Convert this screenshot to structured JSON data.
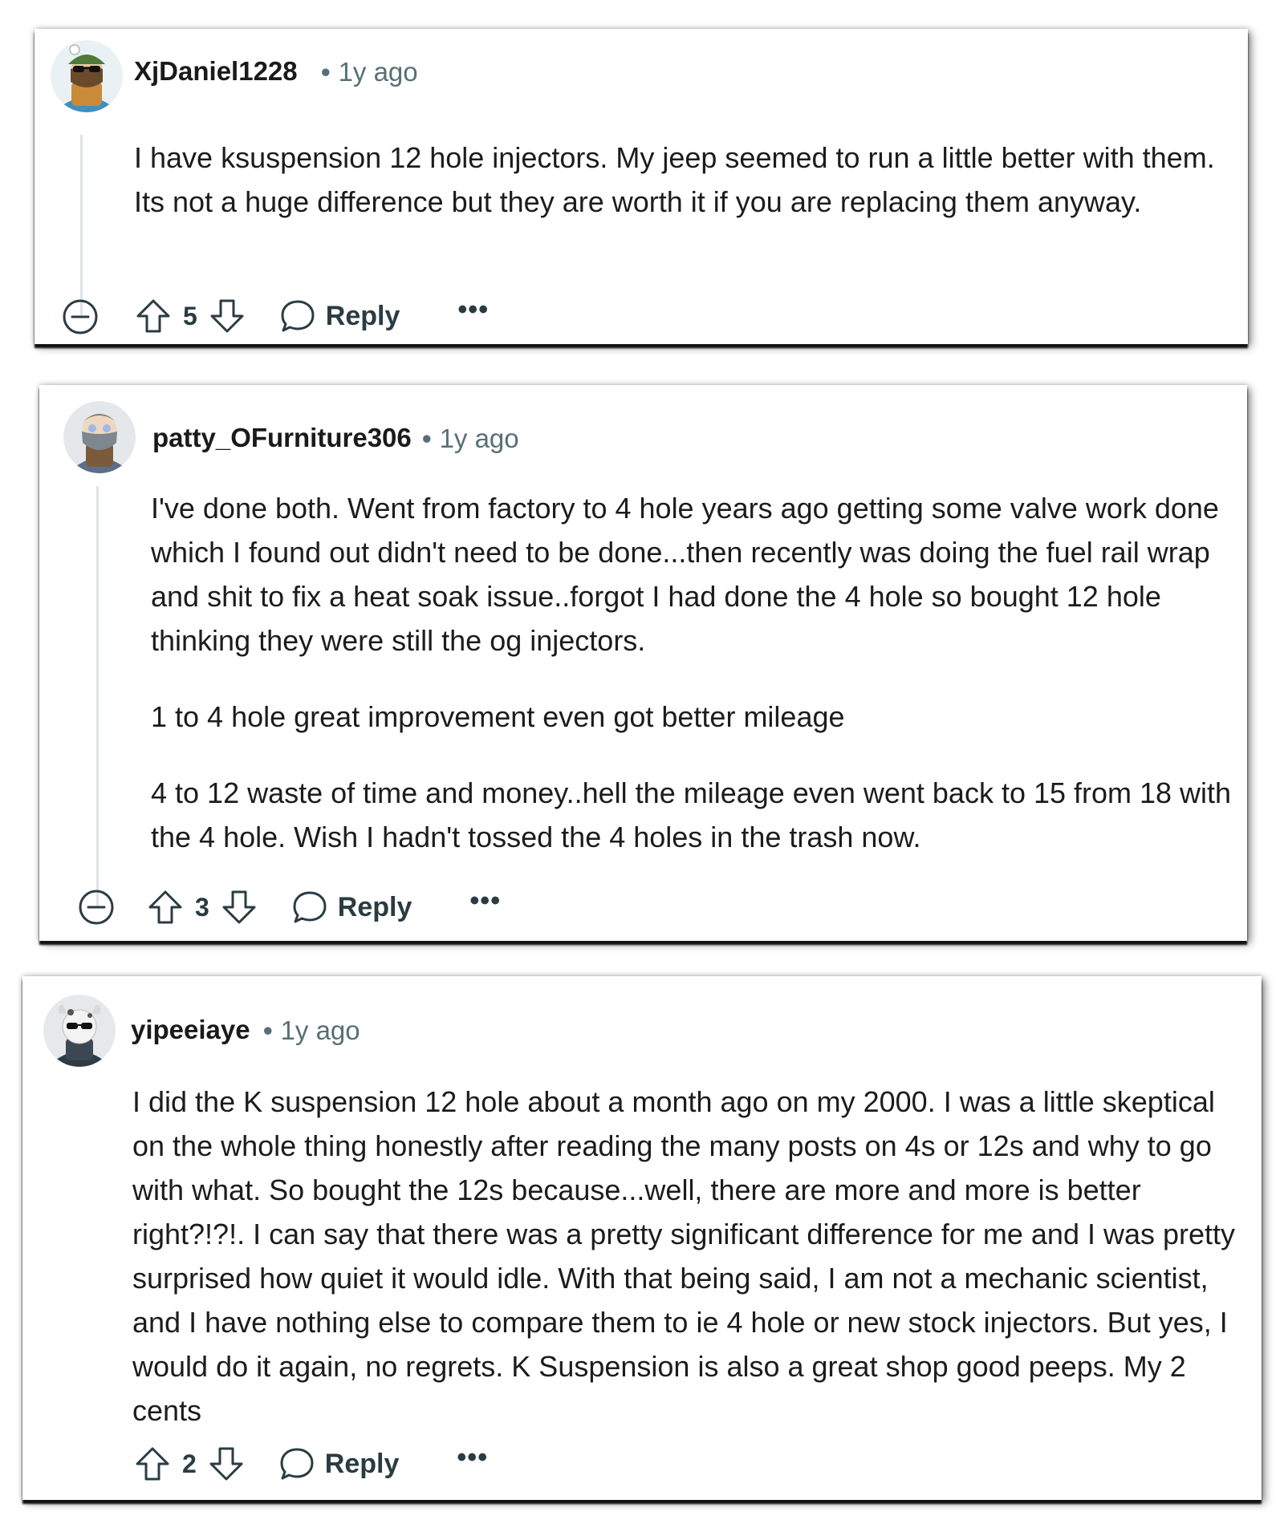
{
  "comments": [
    {
      "username": "XjDaniel1228",
      "time": "1y ago",
      "paragraphs": [
        "I have ksuspension 12 hole injectors. My jeep seemed to run a little better with them. Its not a huge difference but they are worth it if you are replacing them anyway."
      ],
      "votes": "5",
      "reply_label": "Reply",
      "more_label": "•••",
      "avatar_icon": "snoo-avatar-beanie-sunglasses-icon"
    },
    {
      "username": "patty_OFurniture306",
      "time": "1y ago",
      "paragraphs": [
        "I've done both. Went from factory to 4 hole years ago getting some valve work done which I found out didn't need to be done...then recently was doing the fuel rail wrap and shit to fix a heat soak issue..forgot I had done the 4 hole so bought 12 hole thinking they were still the og injectors.",
        "1 to 4 hole great improvement even got better mileage",
        "4 to 12 waste of time and money..hell the mileage even went back to 15 from 18 with the 4 hole. Wish I hadn't tossed the 4 holes in the trash now."
      ],
      "votes": "3",
      "reply_label": "Reply",
      "more_label": "•••",
      "avatar_icon": "snoo-avatar-bearded-icon"
    },
    {
      "username": "yipeeiaye",
      "time": "1y ago",
      "paragraphs": [
        "I did the K suspension 12 hole about a month ago on my 2000. I was a little skeptical on the whole thing honestly after reading the many posts on 4s or 12s and why to go with what. So bought the 12s because...well, there are more and more is better right?!?!. I can say that there was a pretty significant difference for me and I was pretty surprised how quiet it would idle. With that being said, I am not a mechanic scientist, and I have nothing else to compare them to ie 4 hole or new stock injectors. But yes, I would do it again, no regrets. K Suspension is also a great shop good peeps. My 2 cents"
      ],
      "votes": "2",
      "reply_label": "Reply",
      "more_label": "•••",
      "avatar_icon": "snoo-avatar-cow-sunglasses-icon"
    }
  ],
  "meta_separator": "•",
  "colors": {
    "text": "#1c1c1c",
    "meta": "#576f76",
    "action": "#2a3c42",
    "thread_line": "#dfe3e6"
  }
}
